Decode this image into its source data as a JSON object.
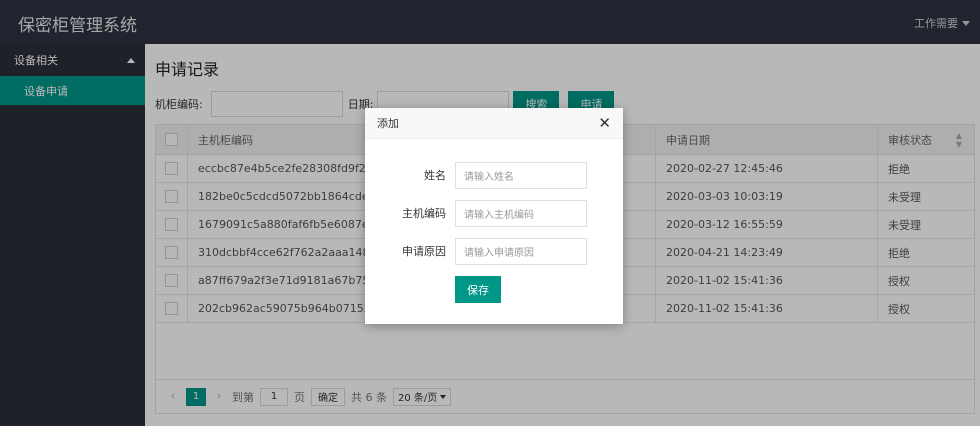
{
  "header": {
    "title": "保密柜管理系统",
    "user_menu": "工作需要"
  },
  "sidebar": {
    "group_label": "设备相关",
    "items": [
      {
        "label": "设备申请"
      }
    ]
  },
  "page": {
    "title": "申请记录"
  },
  "search": {
    "cabinet_label": "机柜编码:",
    "date_label": "日期:",
    "search_button": "搜索",
    "apply_button": "申请"
  },
  "table": {
    "columns": {
      "code": "主机柜编码",
      "date": "申请日期",
      "status": "审核状态"
    },
    "rows": [
      {
        "code": "eccbc87e4b5ce2fe28308fd9f2a7baf3",
        "date": "2020-02-27 12:45:46",
        "status": "拒绝"
      },
      {
        "code": "182be0c5cdcd5072bb1864cdee4d3d6",
        "date": "2020-03-03 10:03:19",
        "status": "未受理"
      },
      {
        "code": "1679091c5a880faf6fb5e6087eb1b2d",
        "date": "2020-03-12 16:55:59",
        "status": "未受理"
      },
      {
        "code": "310dcbbf4cce62f762a2aaa148d556b",
        "date": "2020-04-21 14:23:49",
        "status": "拒绝"
      },
      {
        "code": "a87ff679a2f3e71d9181a67b7542122",
        "date": "2020-11-02 15:41:36",
        "status": "授权"
      },
      {
        "code": "202cb962ac59075b964b07152d234b",
        "date": "2020-11-02 15:41:36",
        "status": "授权"
      }
    ]
  },
  "pager": {
    "current_page": "1",
    "goto_label": "到第",
    "goto_value": "1",
    "page_unit": "页",
    "confirm_button": "确定",
    "total": "共 6 条",
    "page_size": "20 条/页"
  },
  "modal": {
    "title": "添加",
    "fields": [
      {
        "label": "姓名",
        "placeholder": "请输入姓名"
      },
      {
        "label": "主机编码",
        "placeholder": "请输入主机编码"
      },
      {
        "label": "申请原因",
        "placeholder": "请输入申请原因"
      }
    ],
    "save_button": "保存"
  }
}
